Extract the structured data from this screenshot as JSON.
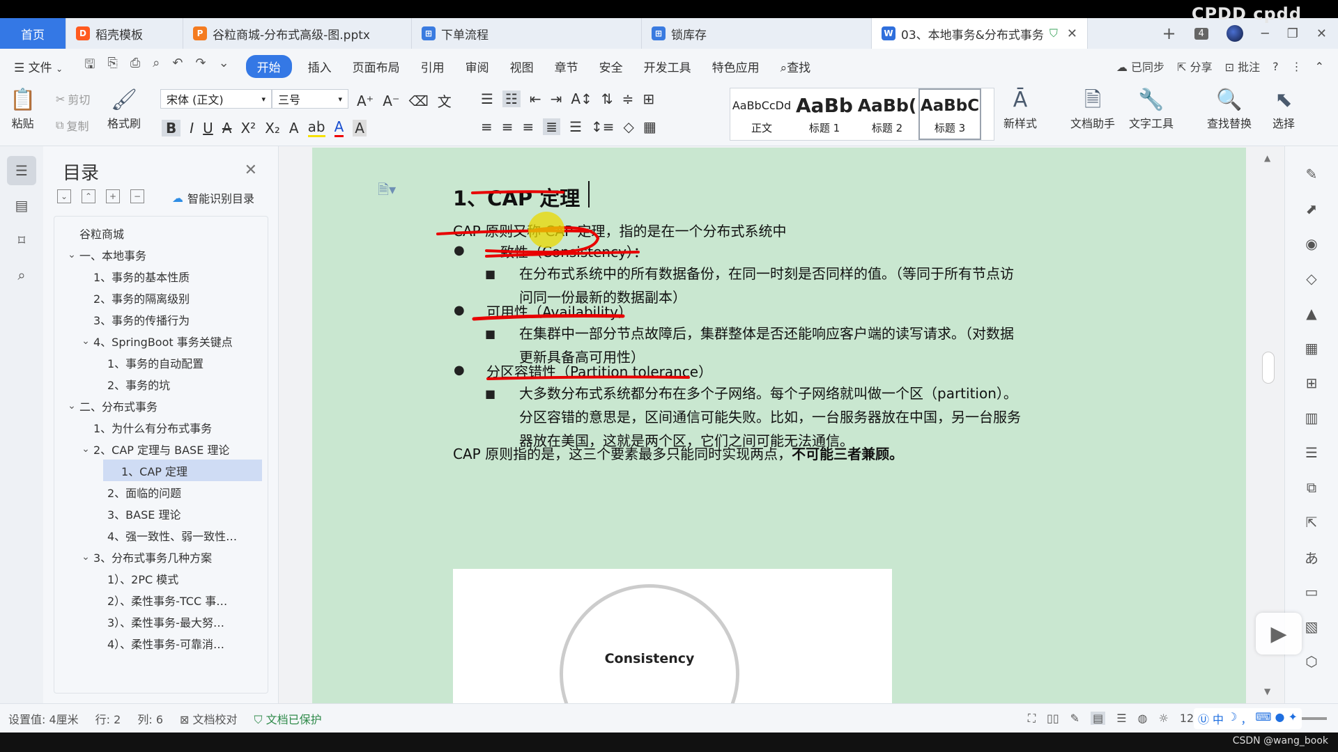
{
  "brand_mark": "CPDD cpdd",
  "tabs": [
    {
      "label": "首页",
      "icon": "home",
      "color": "#3478e5"
    },
    {
      "label": "稻壳模板",
      "icon": "docer-icon",
      "color": "#ff5a1f"
    },
    {
      "label": "谷粒商城-分布式高级-图.pptx",
      "icon": "ppt-icon",
      "color": "#f47b20"
    },
    {
      "label": "下单流程",
      "icon": "flow-icon",
      "color": "#3a7be0"
    },
    {
      "label": "锁库存",
      "icon": "flow-icon",
      "color": "#3a7be0"
    },
    {
      "label": "03、本地事务&分布式事务",
      "icon": "word-icon",
      "color": "#2f6fdc"
    }
  ],
  "tab_count": "4",
  "menu": {
    "file": "文件",
    "items": [
      "开始",
      "插入",
      "页面布局",
      "引用",
      "审阅",
      "视图",
      "章节",
      "安全",
      "开发工具",
      "特色应用",
      "查找"
    ],
    "active": "开始",
    "right": [
      "已同步",
      "分享",
      "批注"
    ]
  },
  "ribbon": {
    "paste": "粘贴",
    "cut": "剪切",
    "copy": "复制",
    "format_painter": "格式刷",
    "font_name": "宋体 (正文)",
    "font_size": "三号",
    "styles": [
      {
        "sample": "AaBbCcDd",
        "name": "正文"
      },
      {
        "sample": "AaBb",
        "name": "标题 1"
      },
      {
        "sample": "AaBb(",
        "name": "标题 2"
      },
      {
        "sample": "AaBbC",
        "name": "标题 3"
      }
    ],
    "new_style": "新样式",
    "doc_assistant": "文档助手",
    "text_tools": "文字工具",
    "find_replace": "查找替换",
    "select": "选择"
  },
  "toc": {
    "title": "目录",
    "smart": "智能识别目录",
    "items": [
      {
        "label": "谷粒商城",
        "level": 0,
        "caret": ""
      },
      {
        "label": "一、本地事务",
        "level": 0,
        "caret": "v"
      },
      {
        "label": "1、事务的基本性质",
        "level": 1,
        "caret": ""
      },
      {
        "label": "2、事务的隔离级别",
        "level": 1,
        "caret": ""
      },
      {
        "label": "3、事务的传播行为",
        "level": 1,
        "caret": ""
      },
      {
        "label": "4、SpringBoot 事务关键点",
        "level": 1,
        "caret": "v"
      },
      {
        "label": "1、事务的自动配置",
        "level": 2,
        "caret": ""
      },
      {
        "label": "2、事务的坑",
        "level": 2,
        "caret": ""
      },
      {
        "label": "二、分布式事务",
        "level": 0,
        "caret": "v"
      },
      {
        "label": "1、为什么有分布式事务",
        "level": 1,
        "caret": ""
      },
      {
        "label": "2、CAP 定理与 BASE 理论",
        "level": 1,
        "caret": "v"
      },
      {
        "label": "1、CAP 定理",
        "level": 2,
        "caret": "",
        "selected": true
      },
      {
        "label": "2、面临的问题",
        "level": 2,
        "caret": ""
      },
      {
        "label": "3、BASE 理论",
        "level": 2,
        "caret": ""
      },
      {
        "label": "4、强一致性、弱一致性…",
        "level": 2,
        "caret": ""
      },
      {
        "label": "3、分布式事务几种方案",
        "level": 1,
        "caret": "v"
      },
      {
        "label": "1）、2PC 模式",
        "level": 2,
        "caret": ""
      },
      {
        "label": "2）、柔性事务-TCC 事…",
        "level": 2,
        "caret": ""
      },
      {
        "label": "3）、柔性事务-最大努…",
        "level": 2,
        "caret": ""
      },
      {
        "label": "4）、柔性事务-可靠消…",
        "level": 2,
        "caret": ""
      }
    ]
  },
  "doc": {
    "heading": "1、CAP 定理",
    "intro": "CAP 原则又称 CAP 定理，指的是在一个分布式系统中",
    "b1": "一致性（Consistency）：",
    "b1_detail_1": "在分布式系统中的所有数据备份，在同一时刻是否同样的值。（等同于所有节点访",
    "b1_detail_2": "问同一份最新的数据副本）",
    "b2": "可用性（Availability）",
    "b2_detail_1": "在集群中一部分节点故障后，集群整体是否还能响应客户端的读写请求。（对数据",
    "b2_detail_2": "更新具备高可用性）",
    "b3": "分区容错性（Partition tolerance）",
    "b3_detail_1": "大多数分布式系统都分布在多个子网络。每个子网络就叫做一个区（partition）。",
    "b3_detail_2": "分区容错的意思是，区间通信可能失败。比如，一台服务器放在中国，另一台服务",
    "b3_detail_3": "器放在美国，这就是两个区，它们之间可能无法通信。",
    "summary_a": "CAP 原则指的是，这三个要素最多只能同时实现两点，",
    "summary_b": "不可能三者兼顾。",
    "figure_label": "Consistency"
  },
  "status": {
    "setting": "设置值: 4厘米",
    "row": "行: 2",
    "col": "列: 6",
    "proofread": "文档校对",
    "protected": "文档已保护",
    "zoom": "120%"
  },
  "ime": [
    "中",
    "，"
  ],
  "watermark": "CSDN @wang_book"
}
